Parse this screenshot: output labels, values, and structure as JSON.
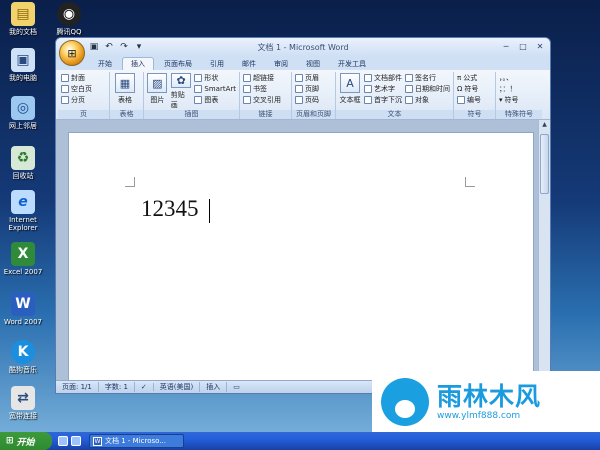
{
  "desktop": {
    "icons": [
      {
        "label": "我的文档",
        "icon": "folder-icon"
      },
      {
        "label": "我的电脑",
        "icon": "computer-icon"
      },
      {
        "label": "网上邻居",
        "icon": "network-icon"
      },
      {
        "label": "回收站",
        "icon": "recycle-bin-icon"
      },
      {
        "label": "Internet Explorer",
        "icon": "ie-icon"
      },
      {
        "label": "Excel 2007",
        "icon": "excel-icon"
      },
      {
        "label": "Word 2007",
        "icon": "word-icon"
      },
      {
        "label": "酷狗音乐",
        "icon": "kugou-icon"
      },
      {
        "label": "宽带连接",
        "icon": "broadband-icon"
      },
      {
        "label": "腾讯QQ",
        "icon": "qq-icon"
      }
    ]
  },
  "window": {
    "title": "文档 1 - Microsoft Word",
    "tabs": [
      "开始",
      "插入",
      "页面布局",
      "引用",
      "邮件",
      "审阅",
      "视图",
      "开发工具"
    ],
    "active_tab": "插入"
  },
  "ribbon": {
    "groups": [
      {
        "label": "页",
        "items": [
          "封面",
          "空白页",
          "分页"
        ]
      },
      {
        "label": "表格",
        "items": [
          "表格"
        ]
      },
      {
        "label": "插图",
        "items": [
          "图片",
          "剪贴画",
          "形状",
          "SmartArt",
          "图表"
        ]
      },
      {
        "label": "链接",
        "items": [
          "超链接",
          "书签",
          "交叉引用"
        ]
      },
      {
        "label": "页眉和页脚",
        "items": [
          "页眉",
          "页脚",
          "页码"
        ]
      },
      {
        "label": "文本",
        "items": [
          "文本框",
          "文档部件",
          "艺术字",
          "首字下沉",
          "签名行",
          "日期和时间",
          "对象"
        ]
      },
      {
        "label": "符号",
        "items": [
          "公式",
          "符号",
          "编号"
        ]
      },
      {
        "label": "特殊符号",
        "items": [
          "符号"
        ]
      }
    ]
  },
  "document": {
    "text": "12345"
  },
  "statusbar": {
    "page": "页面: 1/1",
    "words": "字数: 1",
    "language": "英语(美国)",
    "mode": "插入"
  },
  "taskbar": {
    "start_label": "开始",
    "task_label": "文档 1 - Microso..."
  },
  "watermark": {
    "brand": "雨林木风",
    "url": "www.ylmf888.com"
  },
  "colors": {
    "ribbon_bg": "#dbe7f6",
    "taskbar": "#245edb",
    "start_green": "#2f8a2f",
    "watermark_blue": "#1a9be0"
  }
}
